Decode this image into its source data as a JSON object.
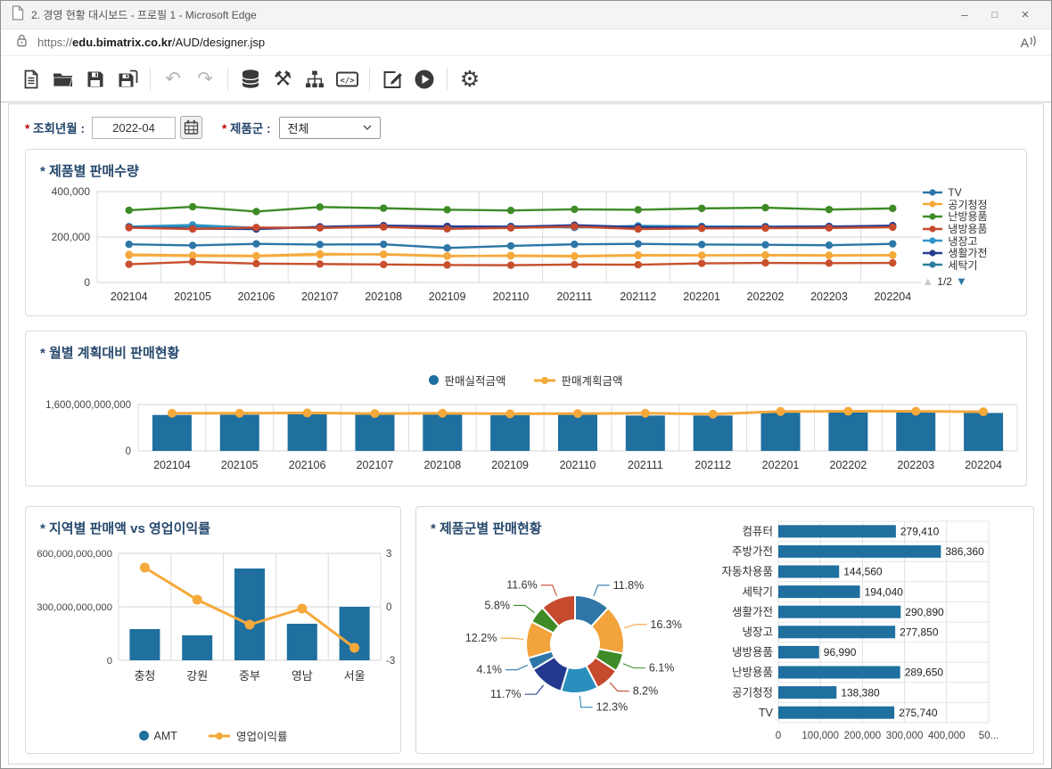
{
  "window": {
    "title": "2. 경영 현황 대시보드 - 프로필 1 - Microsoft Edge"
  },
  "urlbar": {
    "scheme": "https://",
    "domain": "edu.bimatrix.co.kr",
    "path": "/AUD/designer.jsp",
    "read_aloud": "A"
  },
  "toolbar": {
    "icons": [
      "new-document",
      "open-folder",
      "save",
      "save-as",
      "undo",
      "redo",
      "database",
      "tools",
      "hierarchy",
      "code",
      "edit",
      "run",
      "settings"
    ],
    "disabled": [
      "undo",
      "redo"
    ]
  },
  "filters": {
    "required_mark": "*",
    "date_label": "조회년월 :",
    "date_value": "2022-04",
    "product_label": "제품군 :",
    "product_value": "전체"
  },
  "chart_data": [
    {
      "type": "line",
      "title": "* 제품별 판매수량",
      "x": [
        "202104",
        "202105",
        "202106",
        "202107",
        "202108",
        "202109",
        "202110",
        "202111",
        "202112",
        "202201",
        "202202",
        "202203",
        "202204"
      ],
      "ymax": 400000,
      "yticks": [
        {
          "v": 0,
          "label": "0"
        },
        {
          "v": 200000,
          "label": "200,000"
        },
        {
          "v": 400000,
          "label": "400,000"
        }
      ],
      "legend": [
        "TV",
        "공기청정",
        "난방용품",
        "냉방용품",
        "냉장고",
        "생활가전",
        "세탁기"
      ],
      "legend_page": "1/2",
      "series": [
        {
          "name": "세탁기",
          "color": "#2b7f9e",
          "values": [
            244000,
            248000,
            238000,
            242000,
            246000,
            243000,
            242000,
            244000,
            241000,
            242000,
            244000,
            245000,
            247000
          ]
        },
        {
          "name": "냉장고",
          "color": "#2e94c5",
          "values": [
            246000,
            253000,
            240000,
            243000,
            248000,
            244000,
            247000,
            242000,
            249000,
            247000,
            246000,
            247000,
            246000
          ]
        },
        {
          "name": "생활가전",
          "color": "#263c92",
          "values": [
            243000,
            237000,
            235000,
            245000,
            250000,
            247000,
            245000,
            252000,
            244000,
            243000,
            244000,
            246000,
            250000
          ]
        },
        {
          "name": "냉방용품",
          "color": "#c64a2e",
          "values": [
            241000,
            235000,
            242000,
            240000,
            244000,
            236000,
            240000,
            246000,
            235000,
            238000,
            239000,
            240000,
            243000
          ]
        },
        {
          "name": "난방용품",
          "color": "#3e8b27",
          "values": [
            318000,
            333000,
            312000,
            332000,
            327000,
            320000,
            317000,
            322000,
            320000,
            326000,
            329000,
            321000,
            326000
          ]
        },
        {
          "name": "",
          "color": "#f7b95c",
          "values": [
            119000,
            116000,
            115000,
            121000,
            125000,
            118000,
            116000,
            114000,
            118000,
            119000,
            119000,
            118000,
            119000
          ]
        },
        {
          "name": "공기청정",
          "color": "#f5a93b",
          "values": [
            123000,
            120000,
            118000,
            126000,
            123000,
            115000,
            119000,
            117000,
            121000,
            120000,
            121000,
            120000,
            121000
          ]
        },
        {
          "name": "TV",
          "color": "#2d76a7",
          "values": [
            168000,
            163000,
            170000,
            167000,
            168000,
            152000,
            161000,
            168000,
            170000,
            167000,
            166000,
            164000,
            170000
          ]
        },
        {
          "name": "",
          "color": "#c8502e",
          "values": [
            80000,
            91000,
            83000,
            81000,
            79000,
            77000,
            76000,
            79000,
            78000,
            84000,
            86000,
            85000,
            86000
          ]
        }
      ]
    },
    {
      "type": "bar+line",
      "title": "* 월별 계획대비 판매현황",
      "x": [
        "202104",
        "202105",
        "202106",
        "202107",
        "202108",
        "202109",
        "202110",
        "202111",
        "202112",
        "202201",
        "202202",
        "202203",
        "202204"
      ],
      "ymax": 1600000000000,
      "yticks": [
        {
          "v": 0,
          "label": "0"
        },
        {
          "v": 1600000000000,
          "label": "1,600,000,000,000"
        }
      ],
      "series": [
        {
          "name": "판매실적금액",
          "type": "bar",
          "color": "#1f6f9f",
          "values": [
            1240000000000,
            1250000000000,
            1260000000000,
            1245000000000,
            1255000000000,
            1230000000000,
            1245000000000,
            1220000000000,
            1220000000000,
            1320000000000,
            1330000000000,
            1330000000000,
            1310000000000
          ]
        },
        {
          "name": "판매계획금액",
          "type": "line",
          "color": "#f5a93b",
          "values": [
            1300000000000,
            1300000000000,
            1310000000000,
            1290000000000,
            1300000000000,
            1280000000000,
            1290000000000,
            1300000000000,
            1270000000000,
            1360000000000,
            1370000000000,
            1370000000000,
            1350000000000
          ]
        }
      ]
    },
    {
      "type": "bar+line-dual-axis",
      "title": "* 지역별 판매액 vs 영업이익률",
      "x": [
        "충청",
        "강원",
        "중부",
        "영남",
        "서울"
      ],
      "left": {
        "ymax": 600000000000,
        "yticks": [
          {
            "v": 0,
            "label": "0"
          },
          {
            "v": 300000000000,
            "label": "300,000,000,000"
          },
          {
            "v": 600000000000,
            "label": "600,000,000,000"
          }
        ]
      },
      "right": {
        "ymin": -3,
        "ymax": 3,
        "yticks": [
          {
            "v": 3,
            "label": "3"
          },
          {
            "v": 0,
            "label": "0"
          },
          {
            "v": -3,
            "label": "-3"
          }
        ]
      },
      "series": [
        {
          "name": "AMT",
          "type": "bar",
          "axis": "left",
          "color": "#1f6f9f",
          "values": [
            175000000000,
            140000000000,
            515000000000,
            205000000000,
            300000000000
          ]
        },
        {
          "name": "영업이익률",
          "type": "line",
          "axis": "right",
          "color": "#f5a93b",
          "values": [
            2.2,
            0.4,
            -1.0,
            -0.1,
            -2.3
          ]
        }
      ]
    },
    {
      "type": "donut+hbar",
      "title": "* 제품군별 판매현황",
      "donut": {
        "slices": [
          {
            "label": "11.8%",
            "value": 11.8,
            "color": "#2d76a7"
          },
          {
            "label": "16.3%",
            "value": 16.3,
            "color": "#f2a33c"
          },
          {
            "label": "6.1%",
            "value": 6.1,
            "color": "#3e8b27"
          },
          {
            "label": "8.2%",
            "value": 8.2,
            "color": "#c64a2e"
          },
          {
            "label": "12.3%",
            "value": 12.3,
            "color": "#2a8fbd"
          },
          {
            "label": "11.7%",
            "value": 11.7,
            "color": "#24388f"
          },
          {
            "label": "4.1%",
            "value": 4.1,
            "color": "#2d76a7"
          },
          {
            "label": "12.2%",
            "value": 12.2,
            "color": "#f2a33c"
          },
          {
            "label": "5.8%",
            "value": 5.8,
            "color": "#3e8b27"
          },
          {
            "label": "11.6%",
            "value": 11.6,
            "color": "#c64a2e"
          }
        ]
      },
      "hbar": {
        "categories": [
          "컴퓨터",
          "주방가전",
          "자동차용품",
          "세탁기",
          "생활가전",
          "냉장고",
          "냉방용품",
          "난방용품",
          "공기청정",
          "TV"
        ],
        "values": [
          279410,
          386360,
          144560,
          194040,
          290890,
          277850,
          96990,
          289650,
          138380,
          275740
        ],
        "value_labels": [
          "279,410",
          "386,360",
          "144,560",
          "194,040",
          "290,890",
          "277,850",
          "96,990",
          "289,650",
          "138,380",
          "275,740"
        ],
        "xmax": 500000,
        "xticks": [
          {
            "v": 0,
            "label": "0"
          },
          {
            "v": 100000,
            "label": "100,000"
          },
          {
            "v": 200000,
            "label": "200,000"
          },
          {
            "v": 300000,
            "label": "300,000"
          },
          {
            "v": 400000,
            "label": "400,000"
          },
          {
            "v": 500000,
            "label": "50..."
          }
        ],
        "color": "#1f6f9f"
      }
    }
  ]
}
